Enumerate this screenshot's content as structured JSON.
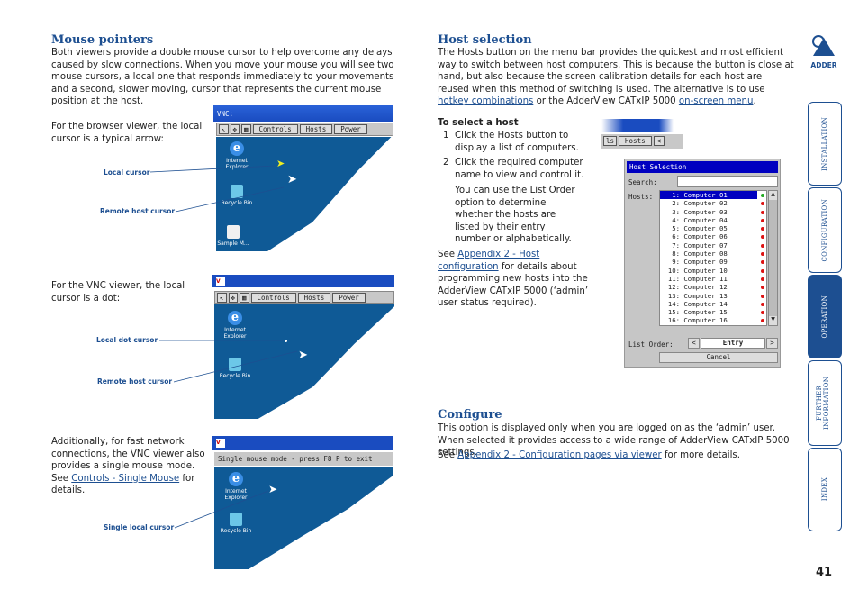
{
  "mouse": {
    "title": "Mouse pointers",
    "intro": "Both viewers provide a double mouse cursor to help overcome any delays caused by slow connections. When you move your mouse you will see two mouse cursors, a local one that responds immediately to your movements and a second, slower moving, cursor that represents the current mouse position at the host.",
    "browser_text": "For the browser viewer, the local cursor is a typical arrow:",
    "vnc_text": "For the VNC viewer, the local cursor is a dot:",
    "single_text_1": "Additionally, for fast network connections, the VNC viewer also provides a single mouse mode. See ",
    "single_link": "Controls - Single Mouse",
    "single_text_2": " for details.",
    "labels": {
      "local_cursor": "Local cursor",
      "remote_cursor": "Remote host cursor",
      "local_dot": "Local dot cursor",
      "remote_cursor2": "Remote host cursor",
      "single_local": "Single local cursor"
    },
    "shot1": {
      "title": "VNC:",
      "buttons": [
        "Controls",
        "Hosts",
        "Power"
      ]
    },
    "shot2": {
      "buttons": [
        "Controls",
        "Hosts",
        "Power"
      ]
    },
    "shot3": {
      "bar": "Single mouse mode - press F8 P to exit"
    },
    "icons": {
      "ie": "Internet Explorer",
      "bin": "Recycle Bin",
      "sample": "Sample M..."
    }
  },
  "host": {
    "title": "Host selection",
    "intro_1": "The Hosts button on the menu bar provides the quickest and most efficient way to switch between host computers. This is because the button is close at hand, but also because the screen calibration details for each host are reused when this method of switching is used. The alternative is to use ",
    "link_hotkey": "hotkey combinations",
    "intro_2": " or the AdderView CATxIP 5000 ",
    "link_osm": "on-screen menu",
    "intro_3": ".",
    "subhead": "To select a host",
    "step1_num": "1",
    "step1": "Click the Hosts button to display a list of computers.",
    "step2_num": "2",
    "step2": "Click the required computer name to view and control it.",
    "step2_note": "You can use the List Order option to determine whether the hosts are listed by their entry number or alphabetically.",
    "see_1": "See ",
    "see_link": "Appendix 2 - Host configuration",
    "see_2": " for details about programming new hosts into the AdderView CATxIP 5000 (‘admin’ user status required).",
    "toolbar": {
      "partial": "ls",
      "hosts": "Hosts",
      "arrow": "<"
    },
    "dialog": {
      "title": "Host Selection",
      "search_label": "Search:",
      "search_value": "",
      "hosts_label": "Hosts:",
      "hosts": [
        {
          "n": "1:",
          "name": "Computer 01",
          "status": "online"
        },
        {
          "n": "2:",
          "name": "Computer 02",
          "status": "offline"
        },
        {
          "n": "3:",
          "name": "Computer 03",
          "status": "offline"
        },
        {
          "n": "4:",
          "name": "Computer 04",
          "status": "offline"
        },
        {
          "n": "5:",
          "name": "Computer 05",
          "status": "offline"
        },
        {
          "n": "6:",
          "name": "Computer 06",
          "status": "offline"
        },
        {
          "n": "7:",
          "name": "Computer 07",
          "status": "offline"
        },
        {
          "n": "8:",
          "name": "Computer 08",
          "status": "offline"
        },
        {
          "n": "9:",
          "name": "Computer 09",
          "status": "offline"
        },
        {
          "n": "10:",
          "name": "Computer 10",
          "status": "offline"
        },
        {
          "n": "11:",
          "name": "Computer 11",
          "status": "offline"
        },
        {
          "n": "12:",
          "name": "Computer 12",
          "status": "offline"
        },
        {
          "n": "13:",
          "name": "Computer 13",
          "status": "offline"
        },
        {
          "n": "14:",
          "name": "Computer 14",
          "status": "offline"
        },
        {
          "n": "15:",
          "name": "Computer 15",
          "status": "offline"
        },
        {
          "n": "16:",
          "name": "Computer 16",
          "status": "offline"
        }
      ],
      "selected_index": 0,
      "list_order_label": "List Order:",
      "list_order_value": "Entry",
      "prev": "<",
      "next": ">",
      "cancel": "Cancel"
    }
  },
  "configure": {
    "title": "Configure",
    "text": "This option is displayed only when you are logged on as the ‘admin’ user. When selected it provides access to a wide range of AdderView CATxIP 5000 settings.",
    "see_1": "See ",
    "see_link": "Appendix 2 - Configuration pages via viewer",
    "see_2": " for more details."
  },
  "sidebar": {
    "logo": "ADDER",
    "tabs": [
      "INSTALLATION",
      "CONFIGURATION",
      "OPERATION",
      "FURTHER INFORMATION",
      "INDEX"
    ],
    "active": "OPERATION"
  },
  "page_number": "41",
  "colors": {
    "accent": "#1d4f91",
    "online": "#22aa22",
    "offline": "#dd1111",
    "dialog_title": "#0000c0"
  }
}
